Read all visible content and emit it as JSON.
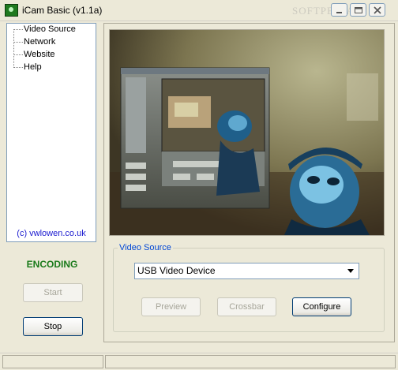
{
  "window": {
    "title": "iCam Basic  (v1.1a)",
    "watermark": "SOFTPEDIA"
  },
  "nav": {
    "items": [
      {
        "label": "Video Source"
      },
      {
        "label": "Network"
      },
      {
        "label": "Website"
      },
      {
        "label": "Help"
      }
    ],
    "credit": "(c) vwlowen.co.uk"
  },
  "status": {
    "text": "ENCODING",
    "color": "#1a7a1a"
  },
  "controls": {
    "start_label": "Start",
    "stop_label": "Stop"
  },
  "video_source": {
    "legend": "Video Source",
    "device": "USB Video Device",
    "preview_label": "Preview",
    "crossbar_label": "Crossbar",
    "configure_label": "Configure"
  },
  "colors": {
    "legend_blue": "#0046d5",
    "credit_blue": "#1a1ad0"
  }
}
